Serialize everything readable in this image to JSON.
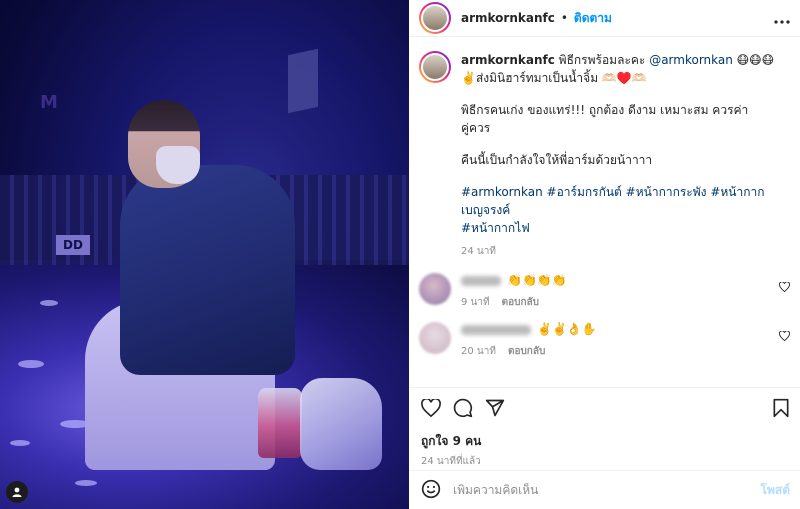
{
  "post": {
    "username": "armkornkanfc",
    "follow_label": "ติดตาม",
    "separator": "•",
    "more_label": "•••"
  },
  "photo": {
    "sign_text": "M",
    "dd_label": "DD"
  },
  "caption": {
    "username": "armkornkanfc",
    "line1_text": "พิธีกรพร้อมละคะ ",
    "mention": "@armkornkan",
    "line1_emoji": " 😷😷😷✌️ส่งมินิฮาร์ทมาเป็นน้ำจิ้ม 🫶🏻♥️🫶🏻",
    "line2": "พิธีกรคนเก่ง ของแทร่!!! ถูกต้อง ดีงาม เหมาะสม ควรค่า คู่ควร",
    "line3": "คืนนี้เป็นกำลังใจให้พี่อาร์มด้วยน้าาาา",
    "hashtags_line1": "#armkornkan #อาร์มกรกันต์ #หน้ากากระพัง #หน้ากากเบญจรงค์",
    "hashtags_line2": "#หน้ากากไฟ",
    "time": "24 นาที"
  },
  "comments": [
    {
      "text": "👏👏👏👏",
      "time": "9 นาที",
      "reply_label": "ตอบกลับ",
      "avatar_color": "#b6a3c9"
    },
    {
      "text": "✌️✌️👌✋",
      "time": "20 นาที",
      "reply_label": "ตอบกลับ",
      "avatar_color": "#d9c8d2"
    }
  ],
  "actions": {
    "likes": "ถูกใจ 9 คน",
    "posted": "24 นาทีที่แล้ว"
  },
  "comment_box": {
    "placeholder": "เพิ่มความคิดเห็น",
    "post_label": "โพสต์"
  },
  "icons": {
    "heart": "heart-icon",
    "comment": "comment-icon",
    "share": "share-icon",
    "save": "bookmark-icon",
    "emoji": "emoji-icon",
    "more": "more-icon",
    "user_tag": "user-tag-icon"
  }
}
